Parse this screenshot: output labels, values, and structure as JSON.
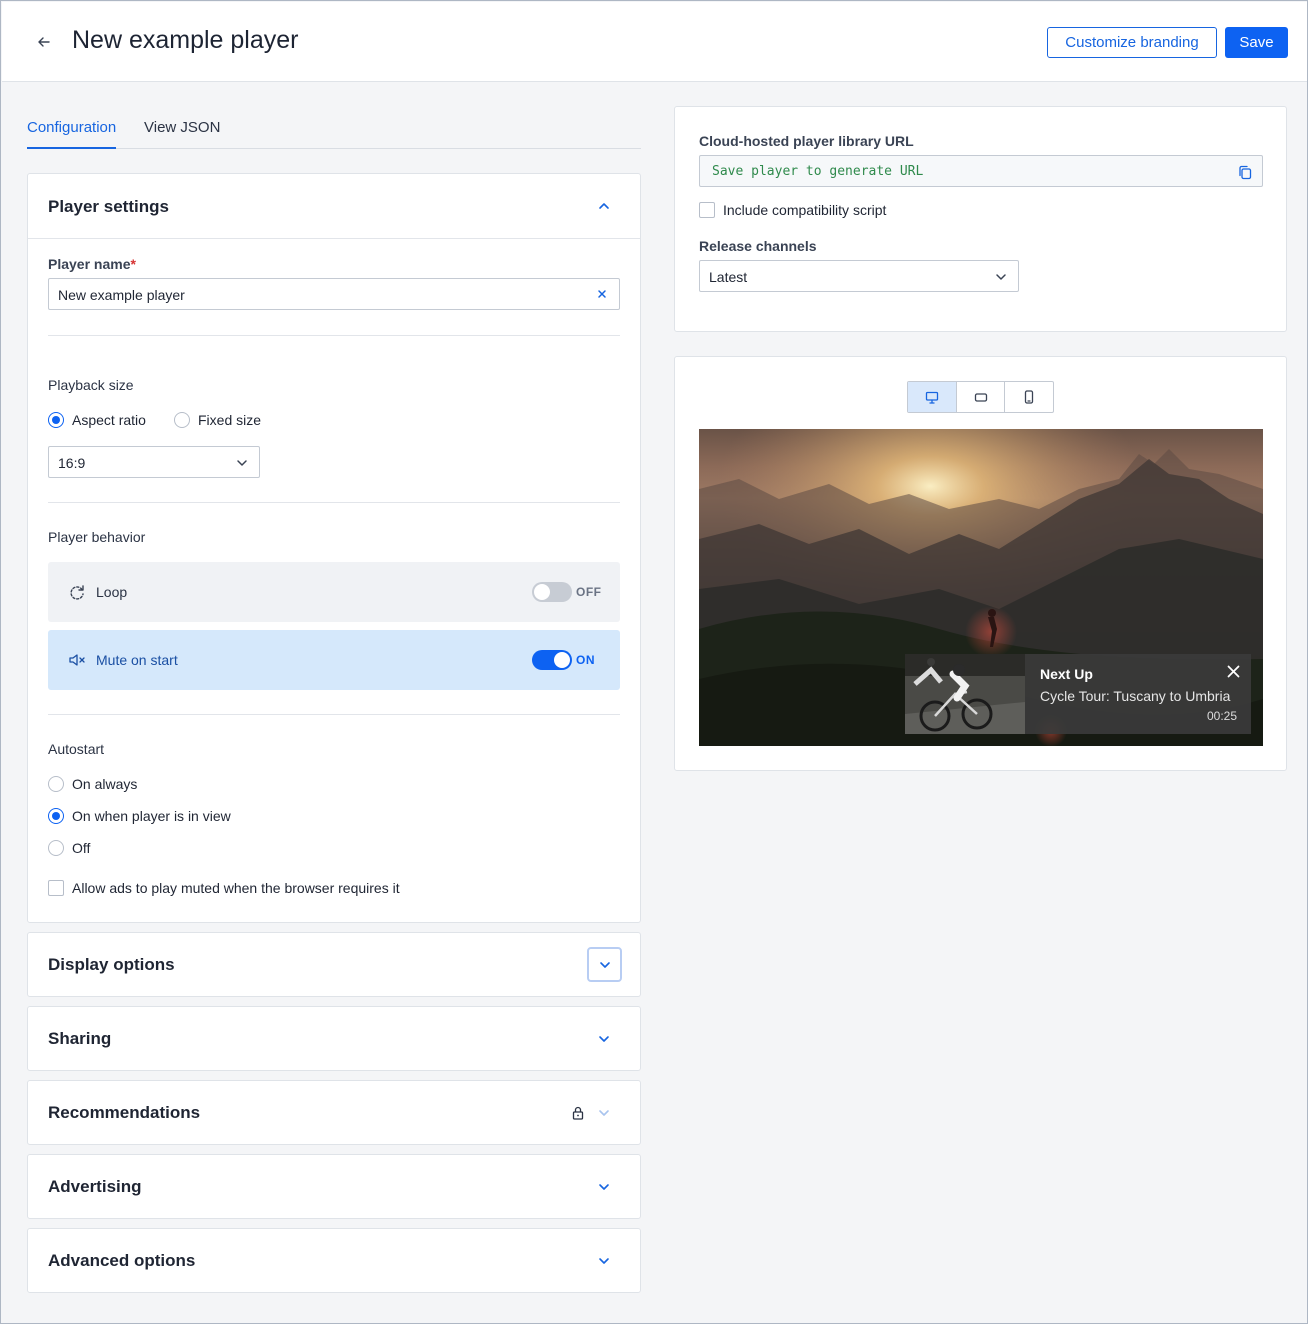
{
  "header": {
    "title": "New example player",
    "customize_label": "Customize branding",
    "save_label": "Save"
  },
  "tabs": [
    {
      "label": "Configuration",
      "active": true
    },
    {
      "label": "View JSON",
      "active": false
    }
  ],
  "player_settings": {
    "title": "Player settings",
    "player_name_label": "Player name",
    "required_mark": "*",
    "player_name_value": "New example player",
    "playback_size_label": "Playback size",
    "size_options": [
      {
        "label": "Aspect ratio",
        "checked": true
      },
      {
        "label": "Fixed size",
        "checked": false
      }
    ],
    "aspect_ratio_value": "16:9",
    "behavior_label": "Player behavior",
    "loop": {
      "label": "Loop",
      "state": "OFF"
    },
    "mute": {
      "label": "Mute on start",
      "state": "ON"
    },
    "autostart_label": "Autostart",
    "autostart_options": [
      {
        "label": "On always",
        "checked": false
      },
      {
        "label": "On when player is in view",
        "checked": true
      },
      {
        "label": "Off",
        "checked": false
      }
    ],
    "allow_ads_label": "Allow ads to play muted when the browser requires it"
  },
  "sections": {
    "display": "Display options",
    "sharing": "Sharing",
    "recommendations": "Recommendations",
    "advertising": "Advertising",
    "advanced": "Advanced options"
  },
  "library": {
    "url_label": "Cloud-hosted player library URL",
    "url_value": "Save player to generate URL",
    "compat_label": "Include compatibility script",
    "release_label": "Release channels",
    "release_value": "Latest"
  },
  "preview": {
    "next_up_label": "Next Up",
    "next_title": "Cycle Tour: Tuscany to Umbria",
    "next_duration": "00:25"
  },
  "colors": {
    "accent": "#0d62f2",
    "link": "#1765e0",
    "mute_bg": "#d5e8fb",
    "url_text": "#2f8a4c"
  }
}
